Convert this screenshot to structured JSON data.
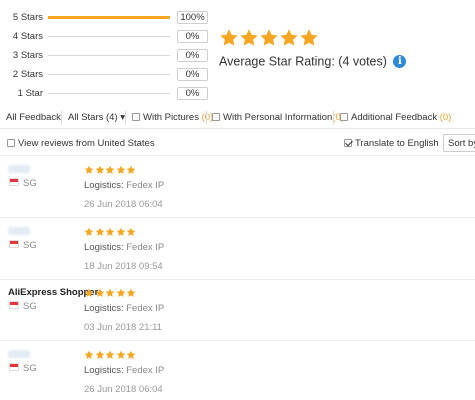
{
  "rating": {
    "distribution": [
      {
        "label": "5 Stars",
        "percent": 100,
        "percent_text": "100%"
      },
      {
        "label": "4 Stars",
        "percent": 0,
        "percent_text": "0%"
      },
      {
        "label": "3 Stars",
        "percent": 0,
        "percent_text": "0%"
      },
      {
        "label": "2 Stars",
        "percent": 0,
        "percent_text": "0%"
      },
      {
        "label": "1 Star",
        "percent": 0,
        "percent_text": "0%"
      }
    ],
    "stars_filled": 5,
    "average_label": "Average Star Rating:",
    "votes_text": "(4 votes)",
    "info_icon": "info-icon",
    "colors": {
      "star": "#f5a623",
      "bar": "#f5a623",
      "info": "#2f89d6"
    }
  },
  "filters": {
    "all_feedback": "All Feedback",
    "all_stars": "All Stars (4)",
    "all_stars_caret": "▾",
    "with_pictures": "With Pictures",
    "with_pictures_count": "(0)",
    "with_personal": "With Personal Information",
    "with_personal_count": "(0)",
    "additional": "Additional Feedback",
    "additional_count": "(0)"
  },
  "options": {
    "view_from": "View reviews from United States",
    "view_from_checked": false,
    "translate": "Translate to English",
    "translate_checked": true,
    "sort_label": "Sort by"
  },
  "reviews": [
    {
      "user": "",
      "country": "SG",
      "stars": 5,
      "logistics_label": "Logistics:",
      "logistics_value": "Fedex IP",
      "date": "26 Jun 2018 06:04"
    },
    {
      "user": "",
      "country": "SG",
      "stars": 5,
      "logistics_label": "Logistics:",
      "logistics_value": "Fedex IP",
      "date": "18 Jun 2018 09:54"
    },
    {
      "user": "AliExpress Shopper",
      "country": "SG",
      "stars": 5,
      "logistics_label": "Logistics:",
      "logistics_value": "Fedex IP",
      "date": "03 Jun 2018 21:11"
    },
    {
      "user": "",
      "country": "SG",
      "stars": 5,
      "logistics_label": "Logistics:",
      "logistics_value": "Fedex IP",
      "date": "26 Jun 2018 06:04"
    }
  ]
}
